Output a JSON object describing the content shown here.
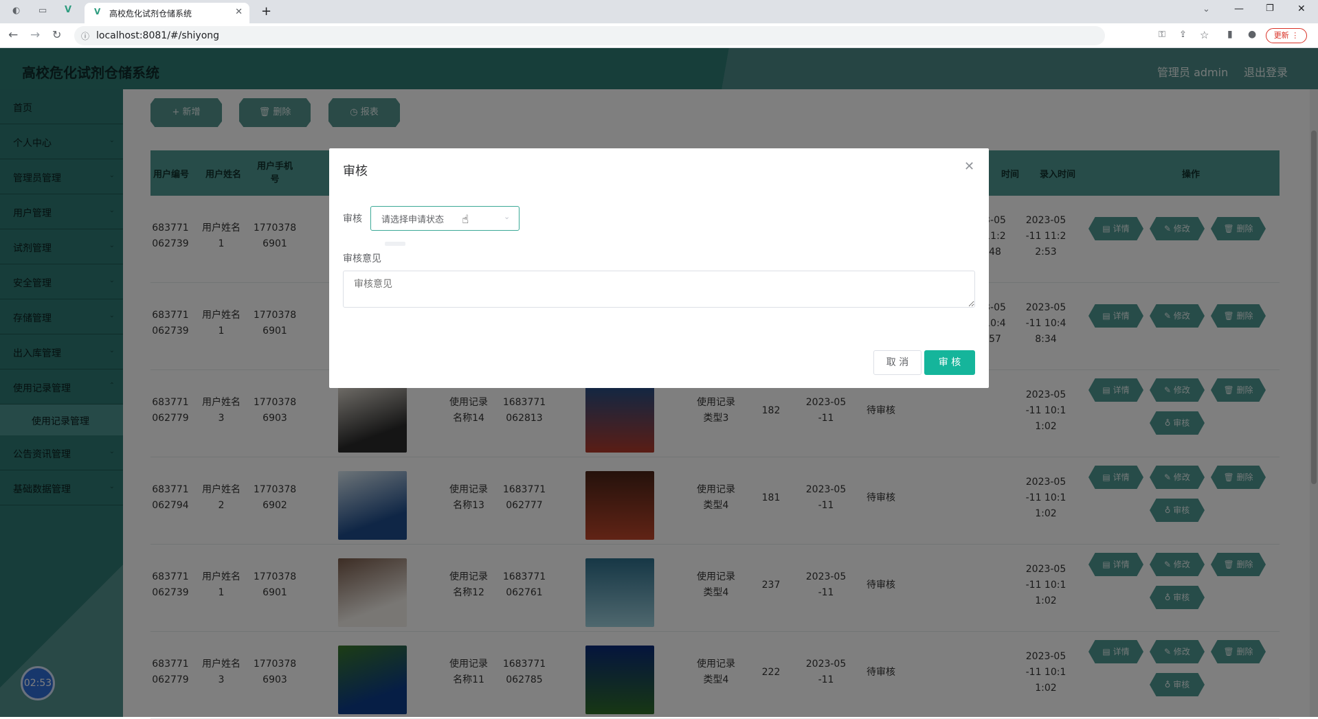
{
  "browser": {
    "tab_title": "高校危化试剂仓储系统",
    "new_tab_glyph": "+",
    "url": "localhost:8081/#/shiyong",
    "update_label": "更新"
  },
  "header": {
    "title": "高校危化试剂仓储系统",
    "admin_label": "管理员 admin",
    "logout_label": "退出登录"
  },
  "sidebar": {
    "items": [
      {
        "label": "首页"
      },
      {
        "label": "个人中心"
      },
      {
        "label": "管理员管理"
      },
      {
        "label": "用户管理"
      },
      {
        "label": "试剂管理"
      },
      {
        "label": "安全管理"
      },
      {
        "label": "存储管理"
      },
      {
        "label": "出入库管理"
      },
      {
        "label": "使用记录管理"
      },
      {
        "label": "公告资讯管理"
      },
      {
        "label": "基础数据管理"
      }
    ],
    "sub_item": "使用记录管理",
    "timer": "02:53"
  },
  "toolbar": {
    "add_label": "+ 新增",
    "delete_label": "删除",
    "report_label": "报表"
  },
  "table": {
    "headers": {
      "user_no": "用户编号",
      "user_name": "用户姓名",
      "user_phone": "用户手机号",
      "time_cut": "时间",
      "entry_time": "录入时间",
      "ops": "操作"
    },
    "ops": {
      "detail": "详情",
      "edit": "修改",
      "delete": "删除",
      "audit": "审核"
    },
    "rows": [
      {
        "user_no": "683771\n062739",
        "user_name": "用户姓名\n1",
        "phone": "1770378\n6901",
        "t1": "3-05\n11:2\n48",
        "t2": "2023-05\n-11 11:2\n2:53"
      },
      {
        "user_no": "683771\n062739",
        "user_name": "用户姓名\n1",
        "phone": "1770378\n6901",
        "t1": "3-05\n10:4\n57",
        "t2": "2023-05\n-11 10:4\n8:34"
      },
      {
        "user_no": "683771\n062779",
        "user_name": "用户姓名\n3",
        "phone": "1770378\n6903",
        "record": "使用记录\n名称14",
        "code": "1683771\n062813",
        "type": "使用记录\n类型3",
        "qty": "182",
        "date": "2023-05\n-11",
        "status": "待审核",
        "t2": "2023-05\n-11 10:1\n1:02"
      },
      {
        "user_no": "683771\n062794",
        "user_name": "用户姓名\n2",
        "phone": "1770378\n6902",
        "record": "使用记录\n名称13",
        "code": "1683771\n062777",
        "type": "使用记录\n类型4",
        "qty": "181",
        "date": "2023-05\n-11",
        "status": "待审核",
        "t2": "2023-05\n-11 10:1\n1:02"
      },
      {
        "user_no": "683771\n062739",
        "user_name": "用户姓名\n1",
        "phone": "1770378\n6901",
        "record": "使用记录\n名称12",
        "code": "1683771\n062761",
        "type": "使用记录\n类型4",
        "qty": "237",
        "date": "2023-05\n-11",
        "status": "待审核",
        "t2": "2023-05\n-11 10:1\n1:02"
      },
      {
        "user_no": "683771\n062779",
        "user_name": "用户姓名\n3",
        "phone": "1770378\n6903",
        "record": "使用记录\n名称11",
        "code": "1683771\n062785",
        "type": "使用记录\n类型4",
        "qty": "222",
        "date": "2023-05\n-11",
        "status": "待审核",
        "t2": "2023-05\n-11 10:1\n1:02"
      }
    ]
  },
  "dialog": {
    "title": "审核",
    "audit_label": "审核",
    "select_placeholder": "请选择申请状态",
    "opinion_label": "审核意见",
    "opinion_placeholder": "审核意见",
    "cancel_label": "取 消",
    "confirm_label": "审 核"
  },
  "colors": {
    "theme": "#2e7b74",
    "confirm": "#15b59b"
  }
}
